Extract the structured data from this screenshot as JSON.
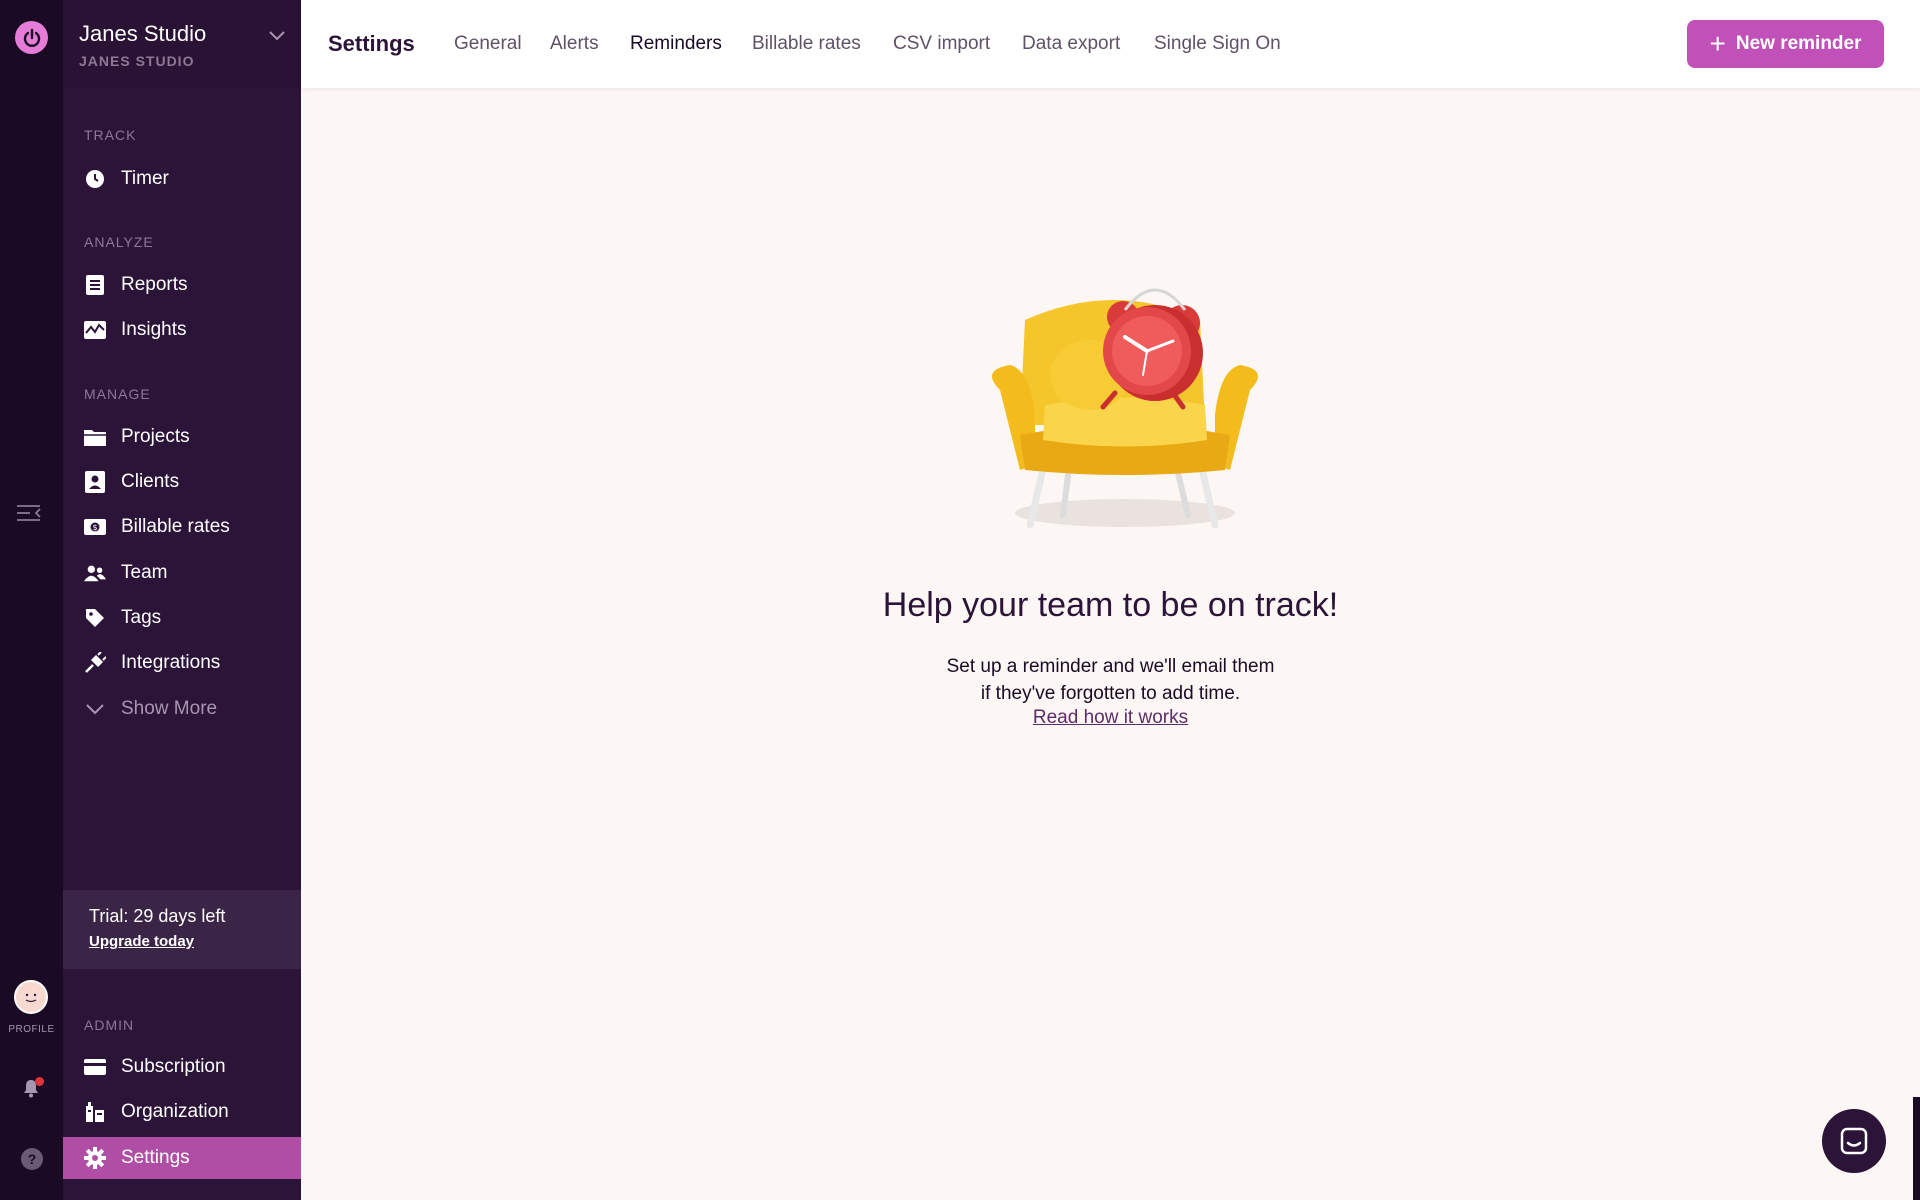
{
  "workspace": {
    "name": "Janes Studio",
    "subtitle": "JANES STUDIO"
  },
  "rail": {
    "profile_label": "PROFILE"
  },
  "sidebar": {
    "sections": {
      "track": "TRACK",
      "analyze": "ANALYZE",
      "manage": "MANAGE",
      "admin": "ADMIN"
    },
    "items": {
      "timer": "Timer",
      "reports": "Reports",
      "insights": "Insights",
      "projects": "Projects",
      "clients": "Clients",
      "billable_rates": "Billable rates",
      "team": "Team",
      "tags": "Tags",
      "integrations": "Integrations",
      "show_more": "Show More",
      "subscription": "Subscription",
      "organization": "Organization",
      "settings": "Settings"
    },
    "trial": {
      "text": "Trial: 29 days left",
      "link": "Upgrade today"
    }
  },
  "header": {
    "title": "Settings",
    "tabs": [
      "General",
      "Alerts",
      "Reminders",
      "Billable rates",
      "CSV import",
      "Data export",
      "Single Sign On"
    ],
    "active_tab": "Reminders",
    "new_button": "New reminder"
  },
  "empty_state": {
    "headline": "Help your team to be on track!",
    "line1": "Set up a reminder and we'll email them",
    "line2": "if they've forgotten to add time.",
    "link": "Read how it works"
  },
  "colors": {
    "accent": "#c150b8",
    "sidebar_bg": "#2c1338",
    "rail_bg": "#1a0a24",
    "page_bg": "#fcf6f4"
  }
}
